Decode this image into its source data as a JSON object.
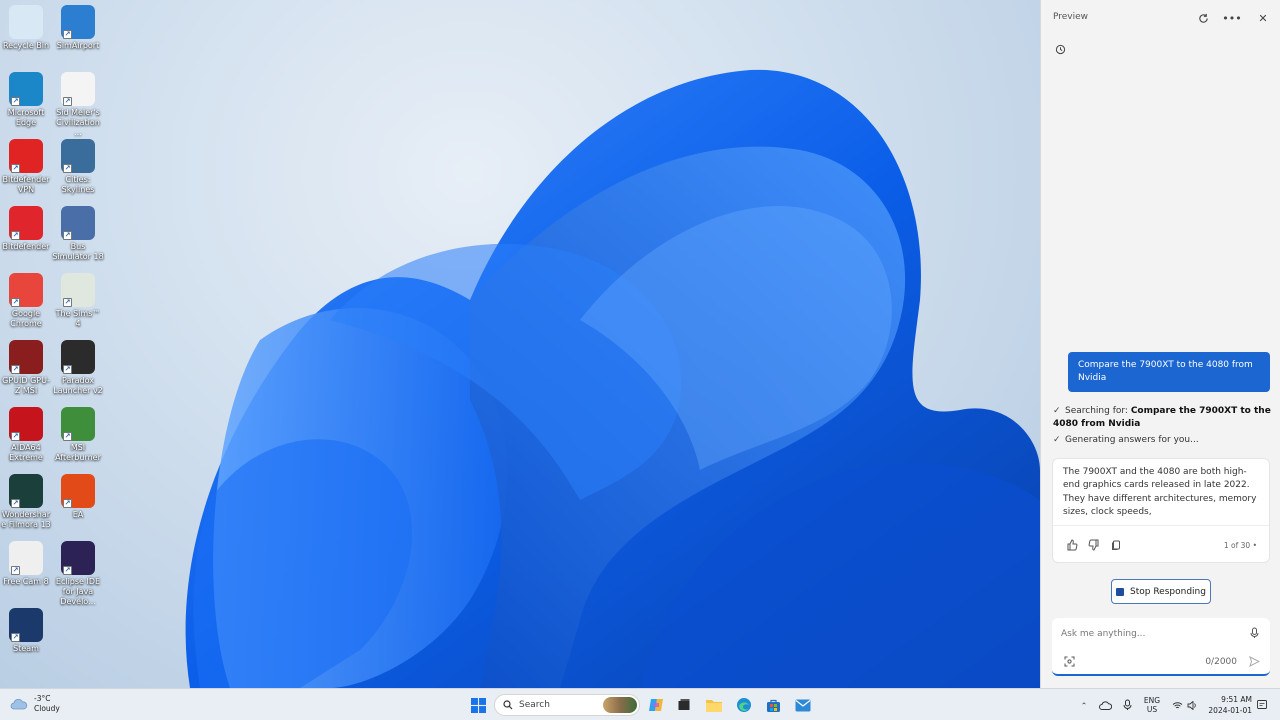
{
  "desktop": {
    "icons": [
      {
        "label": "Recycle Bin",
        "icon": "recycle-bin-icon",
        "color": "#d9e8f5"
      },
      {
        "label": "SimAirport",
        "icon": "plane-icon",
        "color": "#2c7fd0"
      },
      {
        "label": "Microsoft Edge",
        "icon": "edge-icon",
        "color": "#1b86c8"
      },
      {
        "label": "Sid Meier's Civilization ...",
        "icon": "document-icon",
        "color": "#f4f4f4"
      },
      {
        "label": "Bitdefender VPN",
        "icon": "shield-icon",
        "color": "#e02424"
      },
      {
        "label": "Cities: Skylines",
        "icon": "city-icon",
        "color": "#3a6d9b"
      },
      {
        "label": "Bitdefender",
        "icon": "bitdefender-icon",
        "color": "#e0262c"
      },
      {
        "label": "Bus Simulator 18",
        "icon": "bus-icon",
        "color": "#4a6fa8"
      },
      {
        "label": "Google Chrome",
        "icon": "chrome-icon",
        "color": "#e8453c"
      },
      {
        "label": "The Sims™ 4",
        "icon": "plumbob-icon",
        "color": "#dfe7df"
      },
      {
        "label": "GPUID GPU-Z MSI",
        "icon": "gpu-icon",
        "color": "#8a1e1e"
      },
      {
        "label": "Paradox Launcher v2",
        "icon": "paradox-icon",
        "color": "#2b2b2b"
      },
      {
        "label": "AIDA64 Extreme",
        "icon": "aida-icon",
        "color": "#c5141c"
      },
      {
        "label": "MSI Afterburner",
        "icon": "afterburner-icon",
        "color": "#3f8e3c"
      },
      {
        "label": "Wondershare Filmora 13",
        "icon": "filmora-icon",
        "color": "#1b3f3b"
      },
      {
        "label": "EA",
        "icon": "ea-icon",
        "color": "#e24a17"
      },
      {
        "label": "Free Cam 8",
        "icon": "camera-icon",
        "color": "#efefef"
      },
      {
        "label": "Eclipse IDE for Java Develo...",
        "icon": "eclipse-icon",
        "color": "#2c2255"
      },
      {
        "label": "Steam",
        "icon": "steam-icon",
        "color": "#1b3a6b"
      }
    ]
  },
  "panel": {
    "title": "Preview",
    "user_message": "Compare the 7900XT to the 4080 from Nvidia",
    "searching_prefix": "Searching for: ",
    "searching_query": "Compare the 7900XT to the 4080 from Nvidia",
    "generating": "Generating answers for you...",
    "answer": "The 7900XT and the 4080 are both high-end graphics cards released in late 2022. They have different architectures, memory sizes, clock speeds,",
    "page_count": "1 of 30 •",
    "stop_label": "Stop Responding",
    "input_placeholder": "Ask me anything...",
    "char_count": "0/2000",
    "accent": "#1b66d1"
  },
  "taskbar": {
    "weather_temp": "-3°C",
    "weather_desc": "Cloudy",
    "search_label": "Search",
    "lang_line1": "ENG",
    "lang_line2": "US",
    "time": "9:51 AM",
    "date": "2024-01-01"
  }
}
